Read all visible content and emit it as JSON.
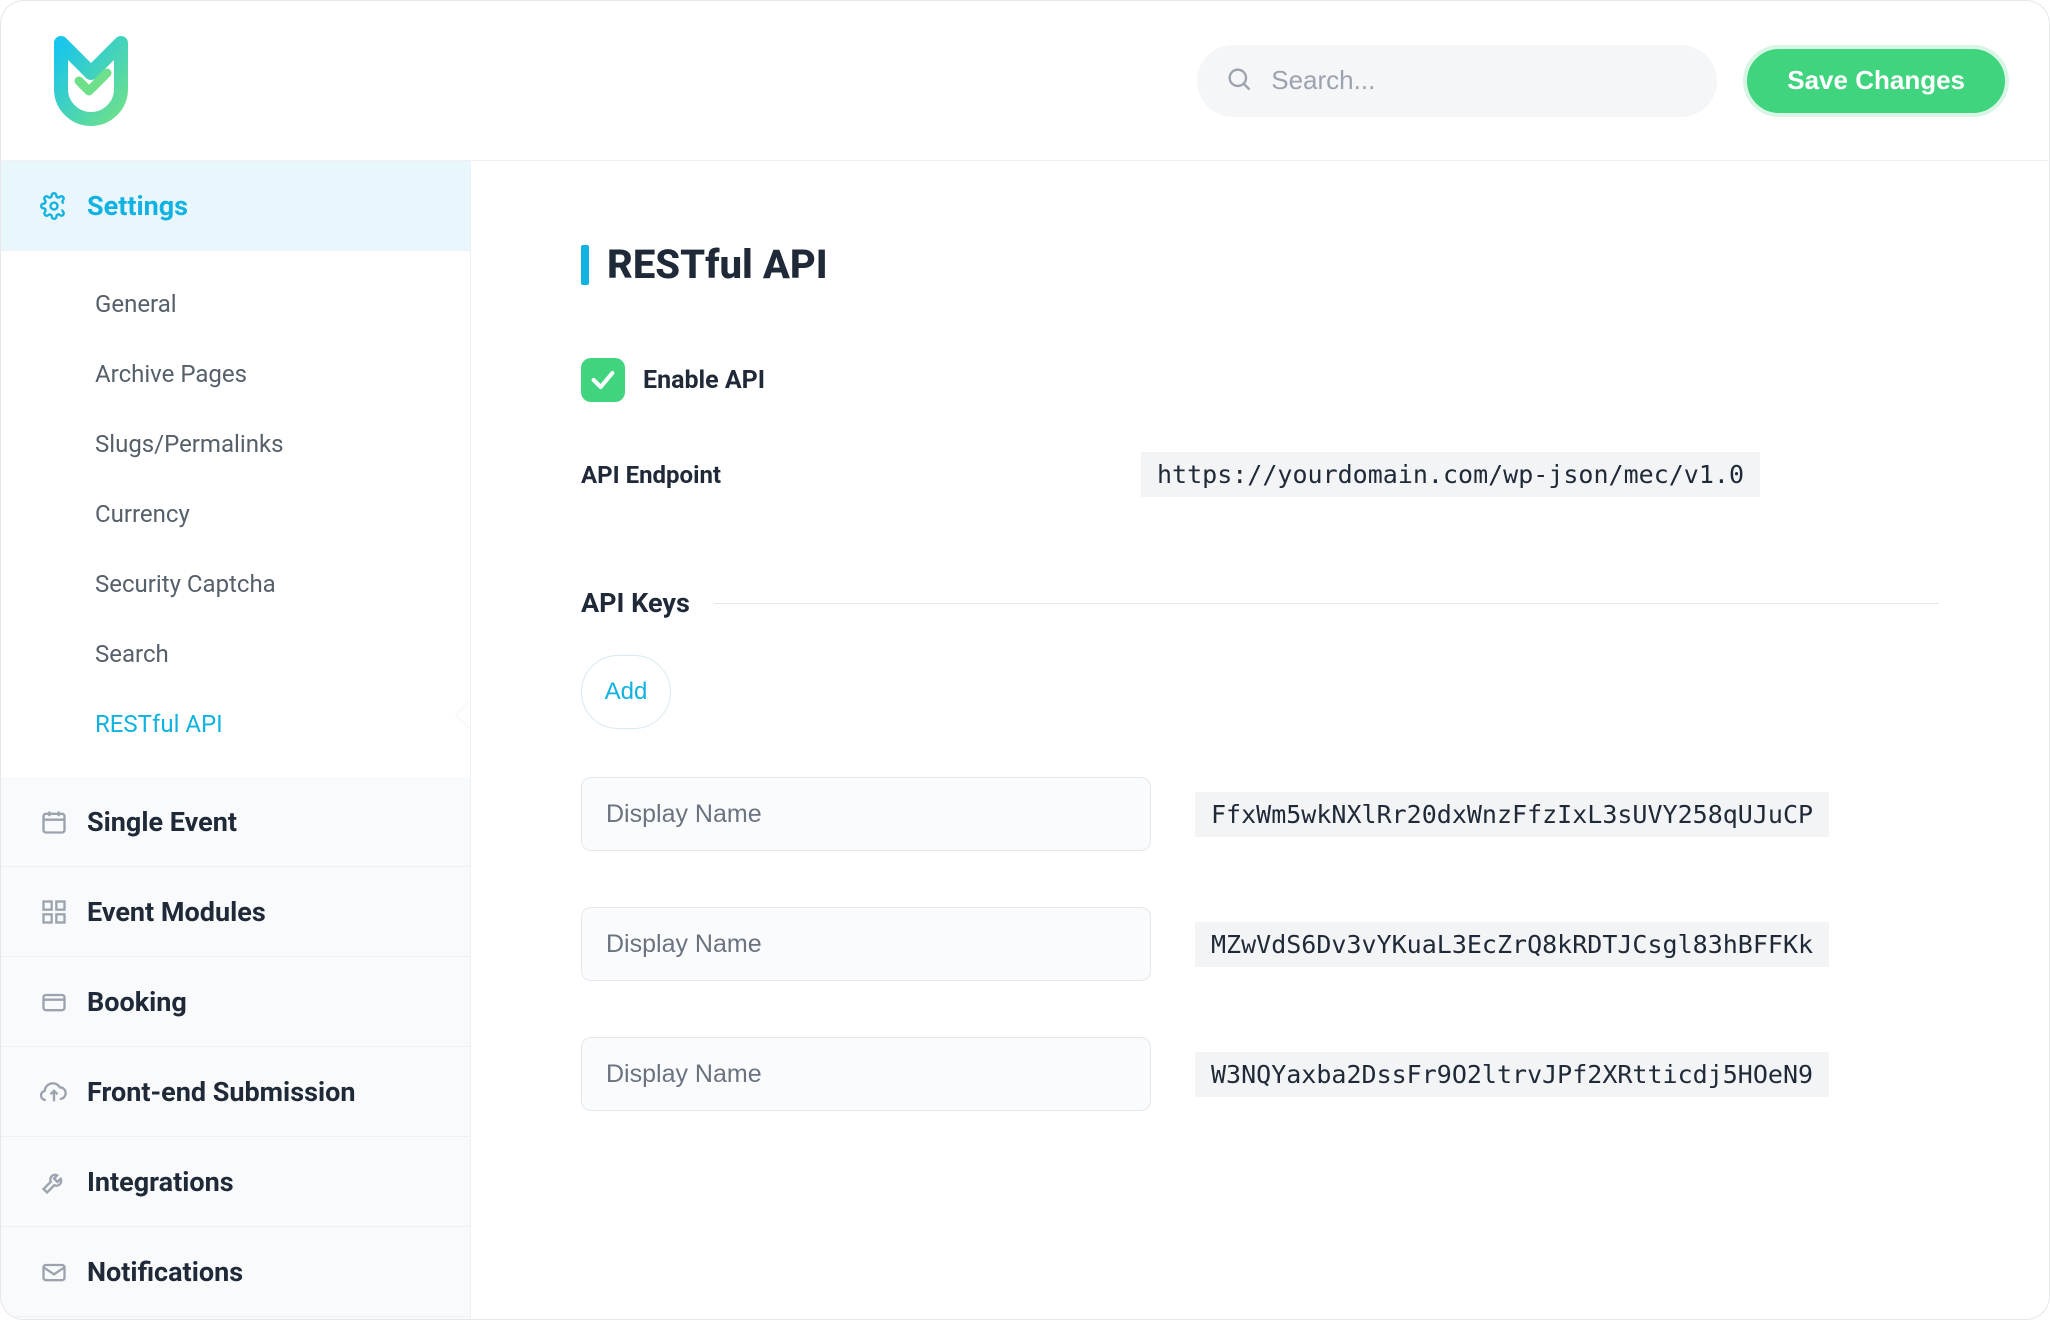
{
  "header": {
    "search_placeholder": "Search...",
    "save_button": "Save Changes"
  },
  "sidebar": {
    "sections": {
      "settings": "Settings",
      "single_event": "Single Event",
      "event_modules": "Event Modules",
      "booking": "Booking",
      "frontend_submission": "Front-end Submission",
      "integrations": "Integrations",
      "notifications": "Notifications"
    },
    "settings_items": {
      "general": "General",
      "archive_pages": "Archive Pages",
      "slugs_permalinks": "Slugs/Permalinks",
      "currency": "Currency",
      "security_captcha": "Security Captcha",
      "search": "Search",
      "restful_api": "RESTful API"
    }
  },
  "main": {
    "title": "RESTful API",
    "enable_label": "Enable API",
    "endpoint_label": "API Endpoint",
    "endpoint_value": "https://yourdomain.com/wp-json/mec/v1.0",
    "api_keys_heading": "API Keys",
    "add_button": "Add",
    "display_name_placeholder": "Display Name",
    "keys": [
      {
        "name": "",
        "value": "FfxWm5wkNXlRr20dxWnzFfzIxL3sUVY258qUJuCP"
      },
      {
        "name": "",
        "value": "MZwVdS6Dv3vYKuaL3EcZrQ8kRDTJCsgl83hBFFKk"
      },
      {
        "name": "",
        "value": "W3NQYaxba2DssFr9O2ltrvJPf2XRtticdj5HOeN9"
      }
    ]
  }
}
